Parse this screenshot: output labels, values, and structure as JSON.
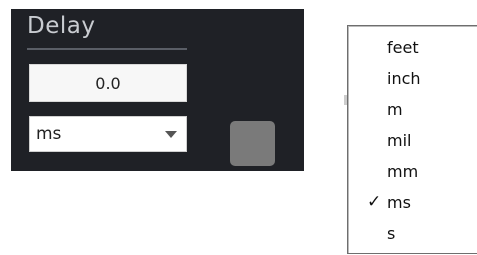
{
  "panel": {
    "title": "Delay",
    "value": "0.0",
    "unit_selected": "ms",
    "swatch_color": "#7a7a7a"
  },
  "menu": {
    "items": [
      {
        "label": "feet",
        "checked": false
      },
      {
        "label": "inch",
        "checked": false
      },
      {
        "label": "m",
        "checked": false
      },
      {
        "label": "mil",
        "checked": false
      },
      {
        "label": "mm",
        "checked": false
      },
      {
        "label": "ms",
        "checked": true
      },
      {
        "label": "s",
        "checked": false
      }
    ],
    "check_glyph": "✓"
  }
}
